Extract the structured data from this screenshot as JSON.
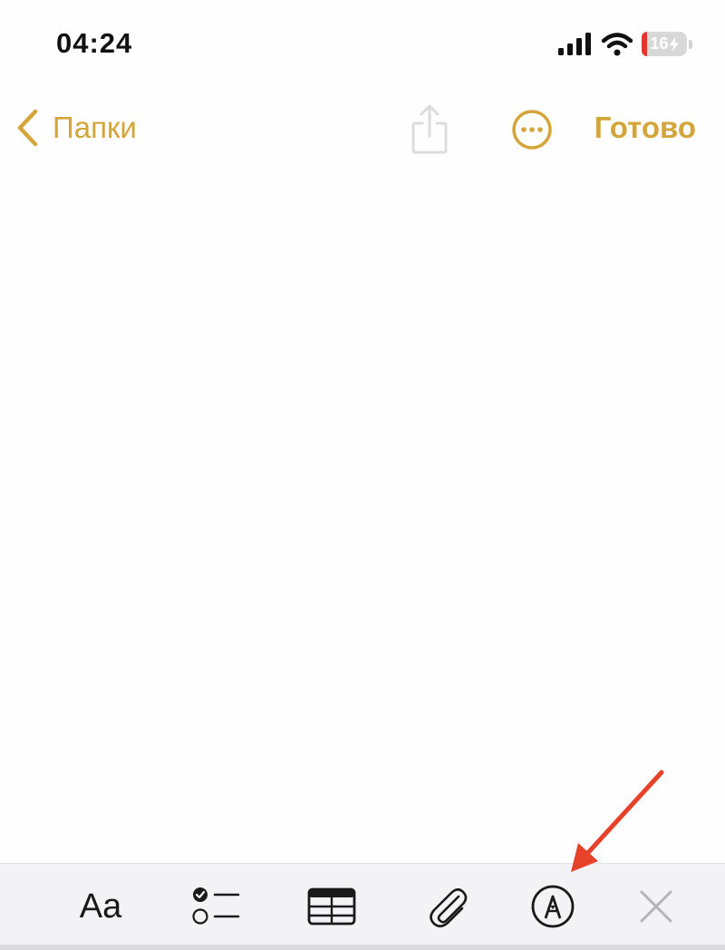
{
  "status_bar": {
    "time": "04:24",
    "battery_percent": "16",
    "icons": [
      "cellular-signal-icon",
      "wifi-icon",
      "battery-icon",
      "charging-bolt-icon"
    ]
  },
  "nav": {
    "back_label": "Папки",
    "done_label": "Готово",
    "icons": [
      "chevron-left-icon",
      "share-icon",
      "more-ellipsis-icon"
    ]
  },
  "toolbar": {
    "format_label": "Aa",
    "items": [
      "format-text",
      "checklist",
      "table",
      "attachment",
      "markup-pen",
      "close"
    ]
  },
  "colors": {
    "accent": "#d4a53a",
    "toolbar_bg": "#f3f3f5",
    "annotation_arrow": "#e8412a"
  }
}
